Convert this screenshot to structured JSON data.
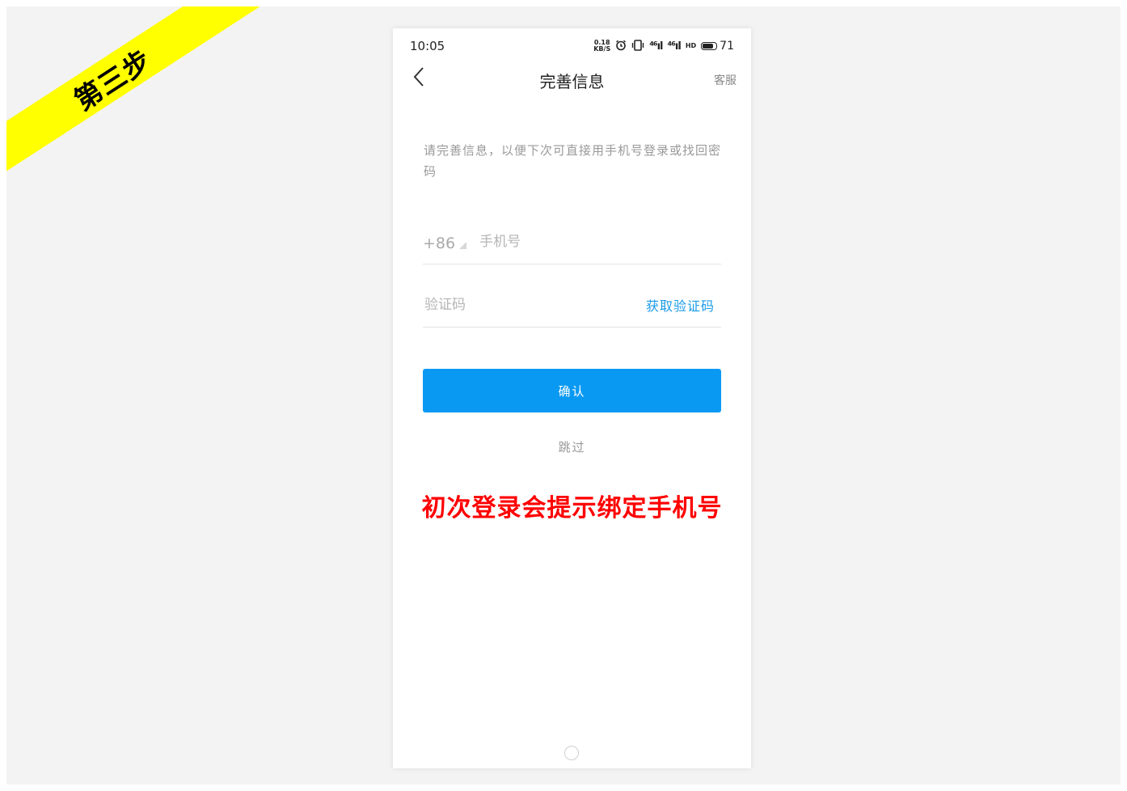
{
  "annotation": {
    "step_ribbon": "第三步",
    "note": "初次登录会提示绑定手机号"
  },
  "status_bar": {
    "time": "10:05",
    "network_speed_value": "0.18",
    "network_speed_unit": "KB/S",
    "signal_1": "⁴⁶ıl",
    "signal_2": "⁴⁶ıl",
    "hd_badge": "HD",
    "battery_level": "71"
  },
  "nav": {
    "title": "完善信息",
    "service_link": "客服"
  },
  "form": {
    "intro_text": "请完善信息，以便下次可直接用手机号登录或找回密码",
    "country_code": "+86",
    "phone_placeholder": "手机号",
    "code_placeholder": "验证码",
    "get_code_label": "获取验证码",
    "confirm_label": "确认",
    "skip_label": "跳过"
  },
  "icons": {
    "back": "chevron-left-icon",
    "alarm": "alarm-clock-icon",
    "vibrate": "vibrate-icon",
    "battery": "battery-icon",
    "home": "home-circle-icon",
    "dropdown": "triangle-dropdown-icon"
  },
  "colors": {
    "accent": "#0a99f2",
    "link": "#1a9be8",
    "ribbon": "#ffff00",
    "note": "#ff0000",
    "background": "#f3f3f3"
  }
}
